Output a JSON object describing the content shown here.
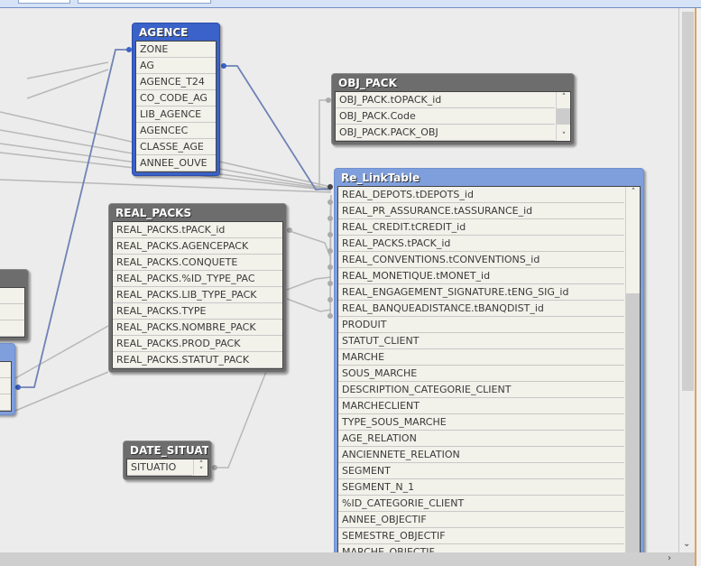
{
  "tables": [
    {
      "id": "agence",
      "title": "AGENCE",
      "style": "blue",
      "fields": [
        "ZONE",
        "AG",
        "AGENCE_T24",
        "CO_CODE_AG",
        "LIB_AGENCE",
        "AGENCEC",
        "CLASSE_AGE",
        "ANNEE_OUVE"
      ]
    },
    {
      "id": "obj_pack",
      "title": "OBJ_PACK",
      "style": "gray",
      "fields": [
        "OBJ_PACK.tOPACK_id",
        "OBJ_PACK.Code",
        "OBJ_PACK.PACK_OBJ"
      ]
    },
    {
      "id": "re_linktable",
      "title": "Re_LinkTable",
      "style": "lblue",
      "fields": [
        "REAL_DEPOTS.tDEPOTS_id",
        "REAL_PR_ASSURANCE.tASSURANCE_id",
        "REAL_CREDIT.tCREDIT_id",
        "REAL_PACKS.tPACK_id",
        "REAL_CONVENTIONS.tCONVENTIONS_id",
        "REAL_MONETIQUE.tMONET_id",
        "REAL_ENGAGEMENT_SIGNATURE.tENG_SIG_id",
        "REAL_BANQUEADISTANCE.tBANQDIST_id",
        "PRODUIT",
        "STATUT_CLIENT",
        "MARCHE",
        "SOUS_MARCHE",
        "DESCRIPTION_CATEGORIE_CLIENT",
        "MARCHECLIENT",
        "TYPE_SOUS_MARCHE",
        "AGE_RELATION",
        "ANCIENNETE_RELATION",
        "SEGMENT",
        "SEGMENT_N_1",
        "%ID_CATEGORIE_CLIENT",
        "ANNEE_OBJECTIF",
        "SEMESTRE_OBJECTIF",
        "MARCHE_OBJECTIF"
      ]
    },
    {
      "id": "real_packs",
      "title": "REAL_PACKS",
      "style": "gray",
      "fields": [
        "REAL_PACKS.tPACK_id",
        "REAL_PACKS.AGENCEPACK",
        "REAL_PACKS.CONQUETE",
        "REAL_PACKS.%ID_TYPE_PAC",
        "REAL_PACKS.LIB_TYPE_PACK",
        "REAL_PACKS.TYPE",
        "REAL_PACKS.NOMBRE_PACK",
        "REAL_PACKS.PROD_PACK",
        "REAL_PACKS.STATUT_PACK"
      ]
    },
    {
      "id": "left_gray",
      "title": "",
      "style": "gray",
      "fields": [
        "",
        "",
        "ON"
      ]
    },
    {
      "id": "left_blue",
      "title": "",
      "style": "lblue",
      "fields": [
        "",
        "",
        ""
      ]
    },
    {
      "id": "date_situati",
      "title": "DATE_SITUATI",
      "style": "gray",
      "fields": [
        "SITUATIO"
      ]
    }
  ],
  "colors": {
    "blue_header": "#3a62c8",
    "light_blue_header": "#7f9fdc",
    "gray_header": "#6d6d6d",
    "link_blue": "#6f82b5",
    "link_gray": "#b8b8b8"
  }
}
